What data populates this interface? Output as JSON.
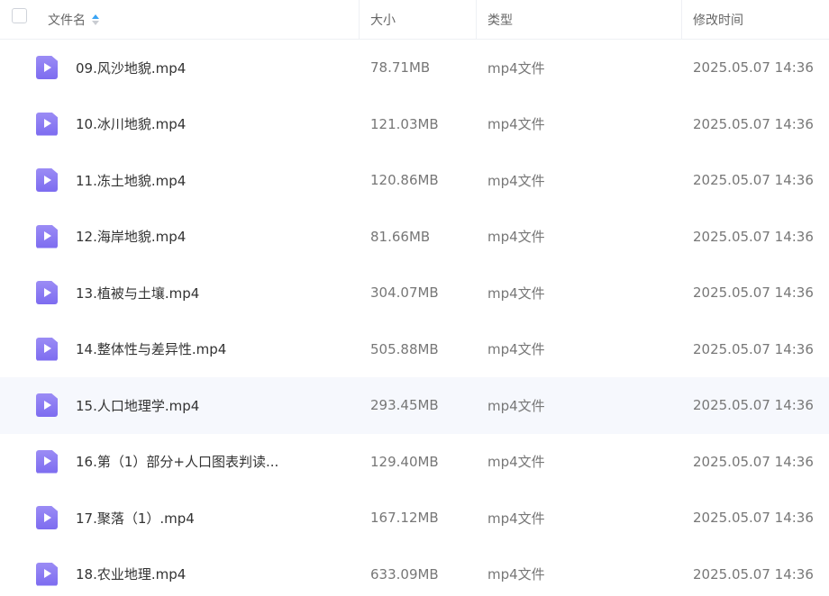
{
  "header": {
    "name_label": "文件名",
    "size_label": "大小",
    "type_label": "类型",
    "modified_label": "修改时间"
  },
  "colors": {
    "accent_sort": "#3aa4f4",
    "file_icon": "#8b7cf3",
    "row_hover": "#f6f8fd"
  },
  "files": [
    {
      "name": "09.风沙地貌.mp4",
      "size": "78.71MB",
      "type": "mp4文件",
      "modified": "2025.05.07 14:36",
      "icon": "video-file-icon"
    },
    {
      "name": "10.冰川地貌.mp4",
      "size": "121.03MB",
      "type": "mp4文件",
      "modified": "2025.05.07 14:36",
      "icon": "video-file-icon"
    },
    {
      "name": "11.冻土地貌.mp4",
      "size": "120.86MB",
      "type": "mp4文件",
      "modified": "2025.05.07 14:36",
      "icon": "video-file-icon"
    },
    {
      "name": "12.海岸地貌.mp4",
      "size": "81.66MB",
      "type": "mp4文件",
      "modified": "2025.05.07 14:36",
      "icon": "video-file-icon"
    },
    {
      "name": "13.植被与土壤.mp4",
      "size": "304.07MB",
      "type": "mp4文件",
      "modified": "2025.05.07 14:36",
      "icon": "video-file-icon"
    },
    {
      "name": "14.整体性与差异性.mp4",
      "size": "505.88MB",
      "type": "mp4文件",
      "modified": "2025.05.07 14:36",
      "icon": "video-file-icon"
    },
    {
      "name": "15.人口地理学.mp4",
      "size": "293.45MB",
      "type": "mp4文件",
      "modified": "2025.05.07 14:36",
      "icon": "video-file-icon"
    },
    {
      "name": "16.第（1）部分+人口图表判读...",
      "size": "129.40MB",
      "type": "mp4文件",
      "modified": "2025.05.07 14:36",
      "icon": "video-file-icon"
    },
    {
      "name": "17.聚落（1）.mp4",
      "size": "167.12MB",
      "type": "mp4文件",
      "modified": "2025.05.07 14:36",
      "icon": "video-file-icon"
    },
    {
      "name": "18.农业地理.mp4",
      "size": "633.09MB",
      "type": "mp4文件",
      "modified": "2025.05.07 14:36",
      "icon": "video-file-icon"
    }
  ]
}
